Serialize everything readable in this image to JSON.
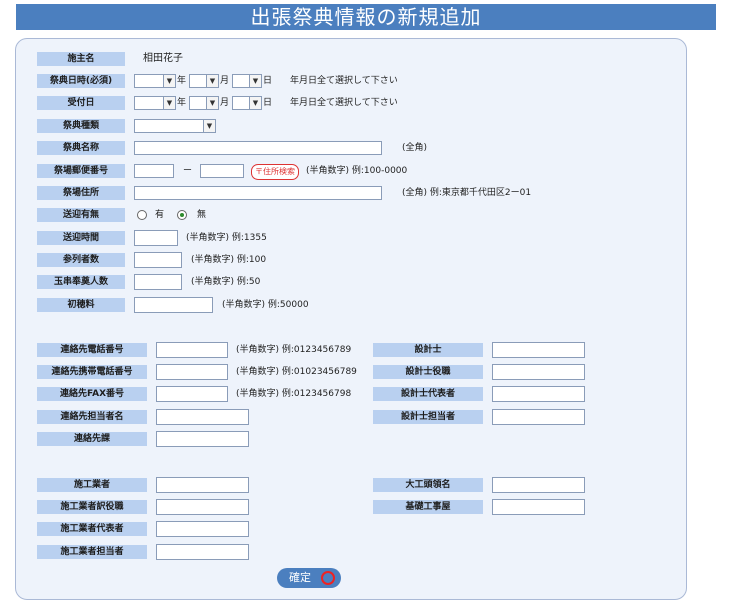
{
  "title": "出張祭典情報の新規追加",
  "fields": {
    "sponsor_label": "施主名",
    "sponsor_value": "相田花子",
    "festival_date_label": "祭典日時(必須)",
    "year_unit": "年",
    "month_unit": "月",
    "day_unit": "日",
    "date_hint": "年月日全て選択して下さい",
    "received_date_label": "受付日",
    "festival_type_label": "祭典種類",
    "festival_name_label": "祭典名称",
    "fullwidth_hint": "(全角)",
    "postal_label": "祭場郵便番号",
    "postal_dash": "ー",
    "postal_search_button": "〒住所検索",
    "postal_hint": "(半角数字) 例:100-0000",
    "address_label": "祭場住所",
    "address_hint": "(全角) 例:東京都千代田区2ー01",
    "shuttle_label": "送迎有無",
    "shuttle_yes": "有",
    "shuttle_no": "無",
    "shuttle_time_label": "送迎時間",
    "shuttle_time_hint": "(半角数字) 例:1355",
    "attendees_label": "参列者数",
    "attendees_hint": "(半角数字) 例:100",
    "tamagushi_label": "玉串奉奠人数",
    "tamagushi_hint": "(半角数字) 例:50",
    "first_fee_label": "初穂料",
    "first_fee_hint": "(半角数字) 例:50000"
  },
  "contact": {
    "phone_label": "連絡先電話番号",
    "phone_hint": "(半角数字) 例:0123456789",
    "mobile_label": "連絡先携帯電話番号",
    "mobile_hint": "(半角数字) 例:01023456789",
    "fax_label": "連絡先FAX番号",
    "fax_hint": "(半角数字) 例:0123456798",
    "person_label": "連絡先担当者名",
    "dept_label": "連絡先課",
    "designer_label": "設計士",
    "designer_role_label": "設計士役職",
    "designer_rep_label": "設計士代表者",
    "designer_person_label": "設計士担当者"
  },
  "builder": {
    "builder_label": "施工業者",
    "builder_role_label": "施工業者訳役職",
    "builder_rep_label": "施工業者代表者",
    "builder_person_label": "施工業者担当者",
    "carpenter_label": "大工頭領名",
    "foundation_label": "基礎工事屋"
  },
  "confirm_label": "確定"
}
